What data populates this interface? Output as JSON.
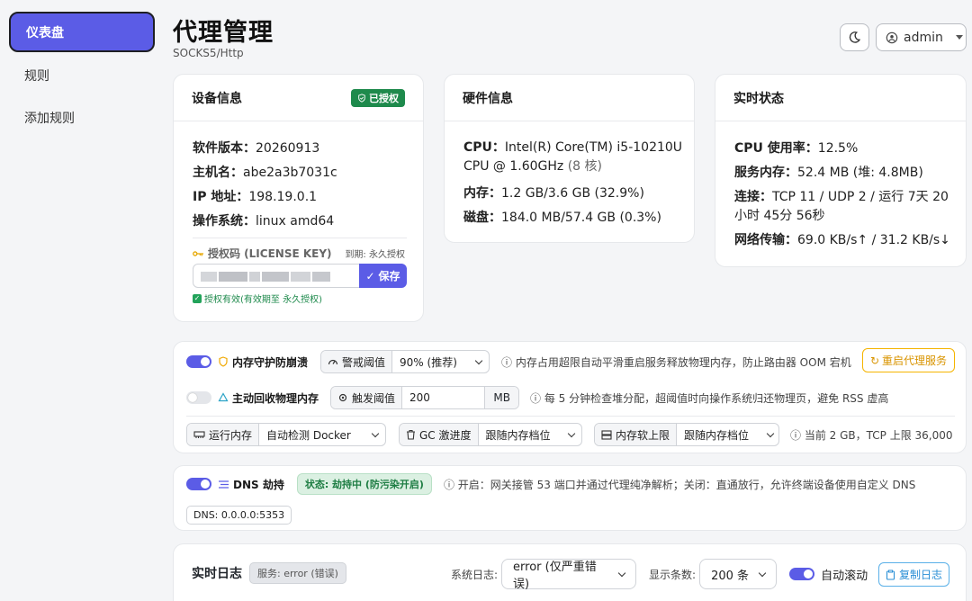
{
  "sidebar": {
    "items": [
      {
        "label": "仪表盘",
        "active": true
      },
      {
        "label": "规则",
        "active": false
      },
      {
        "label": "添加规则",
        "active": false
      }
    ]
  },
  "header": {
    "title": "代理管理",
    "subtitle": "SOCKS5/Http",
    "user": "admin"
  },
  "device": {
    "title": "设备信息",
    "badge": "已授权",
    "software_label": "软件版本：",
    "software_value": "20260913",
    "hostname_label": "主机名：",
    "hostname_value": "abe2a3b7031c",
    "ip_label": "IP 地址：",
    "ip_value": "198.19.0.1",
    "os_label": "操作系统：",
    "os_value": "linux amd64",
    "license_label": "授权码 (LICENSE KEY)",
    "license_expiry": "到期: 永久授权",
    "save_label": "保存",
    "license_status": "授权有效(有效期至 永久授权)"
  },
  "hardware": {
    "title": "硬件信息",
    "cpu_label": "CPU：",
    "cpu_value": "Intel(R) Core(TM) i5-10210U CPU @ 1.60GHz",
    "cpu_cores": "(8 核)",
    "mem_label": "内存：",
    "mem_value": "1.2 GB/3.6 GB (32.9%)",
    "disk_label": "磁盘：",
    "disk_value": "184.0 MB/57.4 GB (0.3%)"
  },
  "realtime": {
    "title": "实时状态",
    "cpu_label": "CPU 使用率：",
    "cpu_value": "12.5%",
    "svc_label": "服务内存：",
    "svc_value": "52.4 MB (堆: 4.8MB)",
    "conn_label": "连接：",
    "conn_value": "TCP 11 / UDP 2 / 运行 7天 20小时 45分 56秒",
    "net_label": "网络传输：",
    "net_value": "69.0 KB/s↑ / 31.2 KB/s↓"
  },
  "memory": {
    "guard_label": "内存守护防崩溃",
    "guard_on": true,
    "threshold_label": "警戒阈值",
    "threshold_value": "90% (推荐)",
    "guard_hint": "内存占用超限自动平滑重启服务释放物理内存，防止路由器 OOM 宕机",
    "restart_label": "重启代理服务",
    "reclaim_label": "主动回收物理内存",
    "reclaim_on": false,
    "trigger_label": "触发阈值",
    "trigger_value": "200",
    "trigger_unit": "MB",
    "reclaim_hint": "每 5 分钟检查堆分配，超阈值时向操作系统归还物理页，避免 RSS 虚高",
    "runtime_label": "运行内存",
    "runtime_value": "自动检测 Docker",
    "gc_label": "GC 激进度",
    "gc_value": "跟随内存档位",
    "soft_label": "内存软上限",
    "soft_value": "跟随内存档位",
    "current_hint": "当前 2 GB，TCP 上限 36,000"
  },
  "dns": {
    "label": "DNS 劫持",
    "on": true,
    "status": "状态: 劫持中 (防污染开启)",
    "hint": "开启：网关接管 53 端口并通过代理纯净解析；关闭：直通放行，允许终端设备使用自定义 DNS",
    "addr": "DNS: 0.0.0.0:5353"
  },
  "logs": {
    "title": "实时日志",
    "service_badge": "服务: error (错误)",
    "syslog_label": "系统日志:",
    "syslog_value": "error (仅严重错误)",
    "count_label": "显示条数:",
    "count_value": "200 条",
    "autoscroll_label": "自动滚动",
    "autoscroll_on": true,
    "copy_label": "复制日志"
  },
  "colors": {
    "accent": "#5b5ce6",
    "success": "#1e8a4c",
    "warning": "#f5b400",
    "info": "#2b8fd6"
  }
}
